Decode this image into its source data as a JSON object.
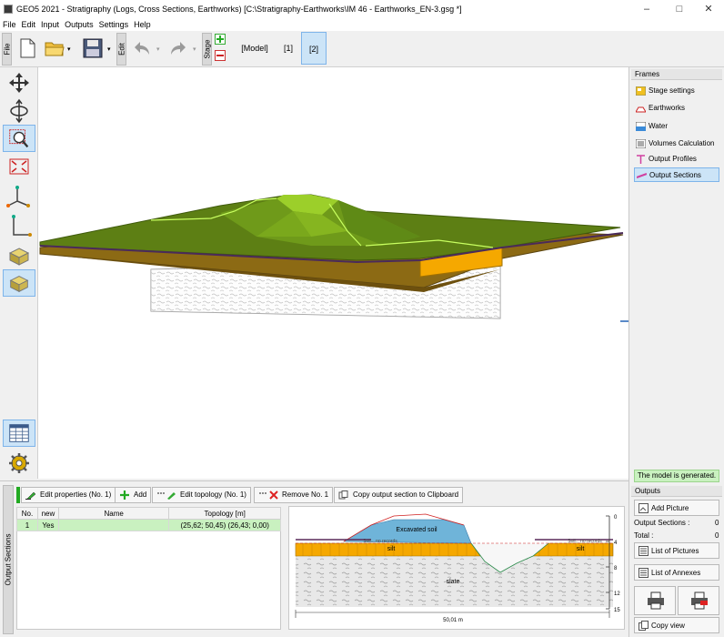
{
  "window": {
    "title": "GEO5 2021 - Stratigraphy (Logs, Cross Sections, Earthworks) [C:\\Stratigraphy-Earthworks\\IM 46 - Earthworks_EN-3.gsg *]"
  },
  "menu": [
    "File",
    "Edit",
    "Input",
    "Outputs",
    "Settings",
    "Help"
  ],
  "toolbar": {
    "file_tab": "File",
    "edit_tab": "Edit",
    "stage_tab": "Stage",
    "stages": [
      "[Model]",
      "[1]",
      "[2]"
    ],
    "active_stage": "[2]"
  },
  "frames": {
    "header": "Frames",
    "items": [
      "Stage settings",
      "Earthworks",
      "Water",
      "Volumes Calculation",
      "Output Profiles",
      "Output Sections"
    ],
    "active": "Output Sections"
  },
  "status": {
    "message": "The model is generated."
  },
  "outputs": {
    "header": "Outputs",
    "add_picture": "Add Picture",
    "output_sections_label": "Output Sections :",
    "output_sections_count": "0",
    "total_label": "Total :",
    "total_count": "0",
    "list_of_pictures": "List of Pictures",
    "list_of_annexes": "List of Annexes",
    "copy_view": "Copy view"
  },
  "bottom": {
    "side_tab": "Output Sections",
    "buttons": {
      "edit_properties": "Edit properties (No. 1)",
      "add": "Add",
      "edit_topology": "Edit topology (No. 1)",
      "remove": "Remove No. 1",
      "copy_clipboard": "Copy output section to Clipboard"
    },
    "table": {
      "columns": [
        "No.",
        "new",
        "Name",
        "Topology [m]"
      ],
      "rows": [
        {
          "no": "1",
          "new": "Yes",
          "name": "",
          "topology": "(25,62; 50,45) (26,43; 0,00)"
        }
      ]
    }
  },
  "section_view": {
    "labels": {
      "excavated": "Excavated soil",
      "silt_left": "silt",
      "silt_right": "silt",
      "slate": "slate",
      "top_left": "Soil... no records",
      "top_right": "Soil... no records",
      "width": "50,01 m"
    },
    "depth_ticks": [
      "0",
      "4",
      "8",
      "12",
      "15"
    ]
  },
  "colors": {
    "accent": "#cce4f7",
    "terrain": "#6b8e23",
    "silt": "#f5a800",
    "excavated": "#6fb4d9",
    "status_bg": "#c9f1c0"
  }
}
